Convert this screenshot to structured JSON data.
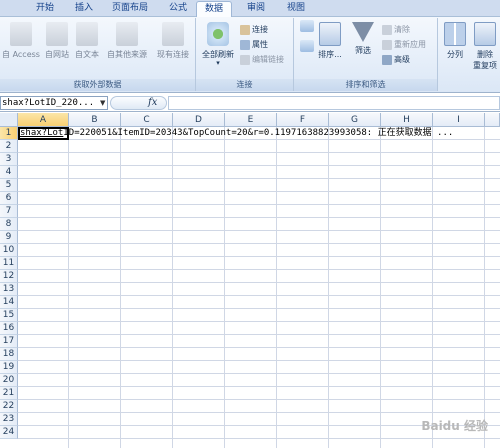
{
  "tabs": [
    "开始",
    "插入",
    "页面布局",
    "公式",
    "数据",
    "审阅",
    "视图"
  ],
  "ribbon": {
    "groups": {
      "external": {
        "label": "获取外部数据",
        "buttons": [
          "自 Access",
          "自网站",
          "自文本",
          "自其他来源",
          "现有连接"
        ]
      },
      "connections": {
        "label": "连接",
        "refresh": "全部刷新",
        "small": [
          "连接",
          "属性",
          "编辑链接"
        ]
      },
      "sort_filter": {
        "label": "排序和筛选",
        "sort": "排序...",
        "filter": "筛选",
        "small": [
          "清除",
          "重新应用",
          "高级"
        ]
      },
      "tools": {
        "split": "分列",
        "remove_dup_1": "删除",
        "remove_dup_2": "重复项"
      }
    }
  },
  "formula_bar": {
    "name_box": "shax?LotID_220...",
    "fx": "fx",
    "value": ""
  },
  "sheet": {
    "columns": [
      "A",
      "B",
      "C",
      "D",
      "E",
      "F",
      "G",
      "H",
      "I"
    ],
    "rows": [
      "1",
      "2",
      "3",
      "4",
      "5",
      "6",
      "7",
      "8",
      "9",
      "10",
      "11",
      "12",
      "13",
      "14",
      "15",
      "16",
      "17",
      "18",
      "19",
      "20",
      "21",
      "22",
      "23",
      "24"
    ],
    "a1_link": "shax?Lot",
    "a1_rest": "ID=220051&ItemID=20343&TopCount=20&r=0.11971638823993058: 正在获取数据 ..."
  },
  "watermark": "Baidu 经验"
}
